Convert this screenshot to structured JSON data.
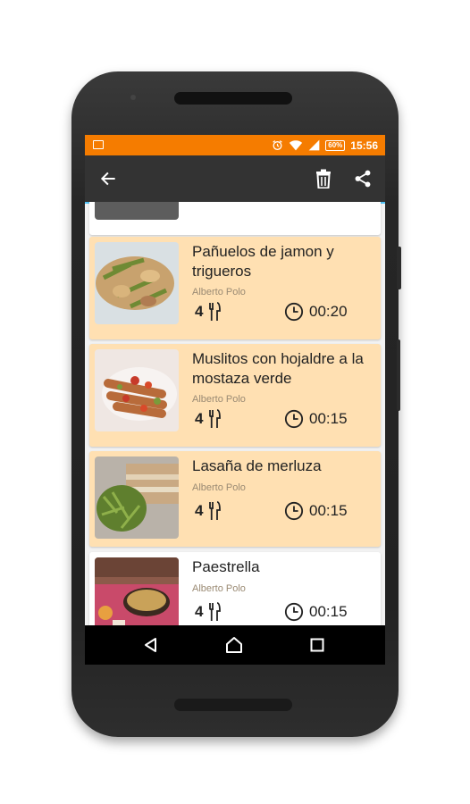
{
  "status_bar": {
    "time": "15:56",
    "battery": "60%",
    "icons": [
      "image-icon",
      "alarm-icon",
      "wifi-icon",
      "signal-icon",
      "battery-icon"
    ]
  },
  "toolbar": {
    "icons": [
      "back-arrow-icon",
      "trash-icon",
      "share-icon"
    ]
  },
  "recipes": [
    {
      "title": "Pañuelos de jamon y trigueros",
      "author": "Alberto Polo",
      "servings": "4",
      "time": "00:20",
      "thumb_colors": [
        "#cfd8dc",
        "#c8a26e",
        "#7a8f3e"
      ]
    },
    {
      "title": "Muslitos con hojaldre a la mostaza verde",
      "author": "Alberto Polo",
      "servings": "4",
      "time": "00:15",
      "thumb_colors": [
        "#efe7e3",
        "#b86b3a",
        "#c73a2a"
      ]
    },
    {
      "title": "Lasaña de merluza",
      "author": "Alberto Polo",
      "servings": "4",
      "time": "00:15",
      "thumb_colors": [
        "#c9a983",
        "#6d8a3a",
        "#e3d2b6"
      ]
    },
    {
      "title": "Paestrella",
      "author": "Alberto Polo",
      "servings": "4",
      "time": "00:15",
      "thumb_colors": [
        "#8c5a4a",
        "#c9a259",
        "#d63a5a"
      ]
    }
  ],
  "colors": {
    "status_bar": "#f57c00",
    "toolbar": "#333333",
    "card_highlight": "#ffe0b2",
    "card_default": "#ffffff",
    "scroll_accent": "#4fc3f7"
  },
  "nav_bar": {
    "icons": [
      "back-triangle-icon",
      "home-icon",
      "recents-icon"
    ]
  }
}
